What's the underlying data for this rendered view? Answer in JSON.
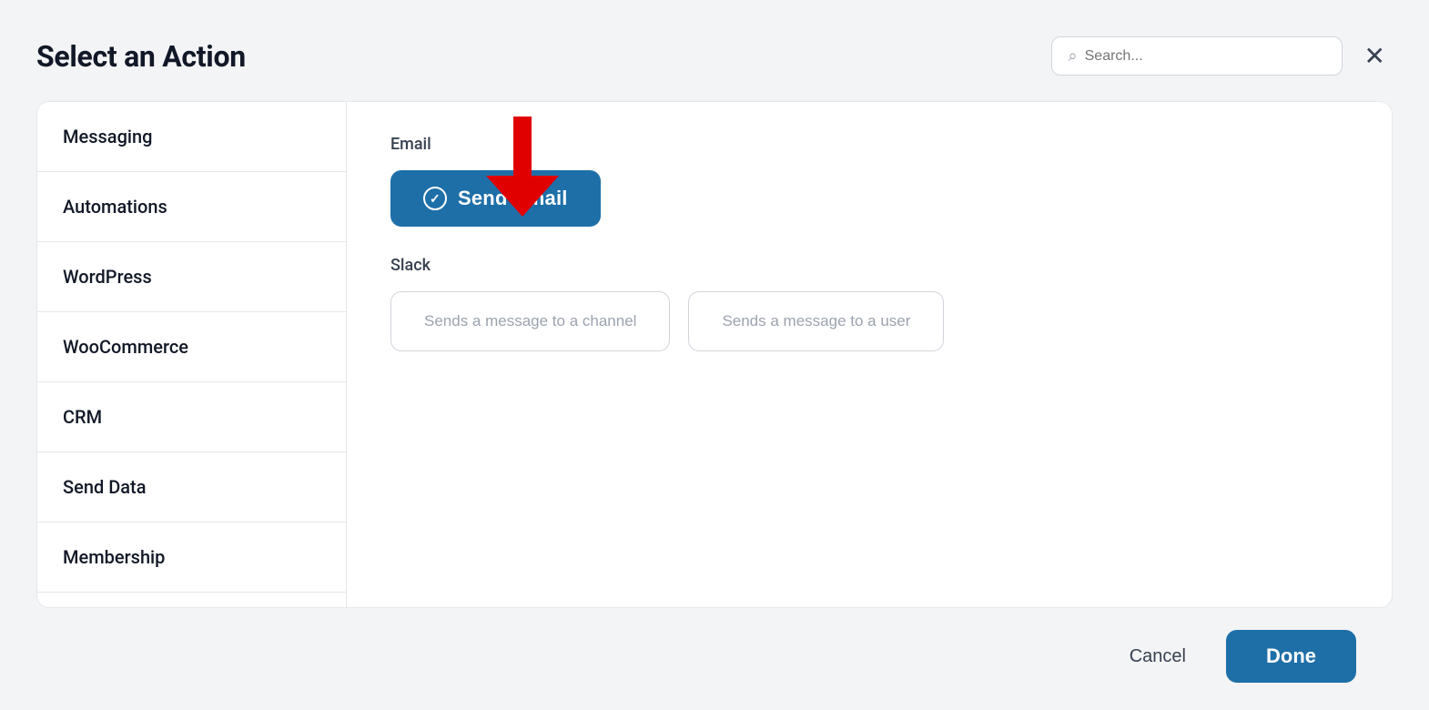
{
  "header": {
    "title": "Select an Action",
    "search_placeholder": "Search...",
    "close_label": "✕"
  },
  "sidebar": {
    "items": [
      {
        "id": "messaging",
        "label": "Messaging",
        "active": false
      },
      {
        "id": "automations",
        "label": "Automations",
        "active": false
      },
      {
        "id": "wordpress",
        "label": "WordPress",
        "active": false
      },
      {
        "id": "woocommerce",
        "label": "WooCommerce",
        "active": false
      },
      {
        "id": "crm",
        "label": "CRM",
        "active": false
      },
      {
        "id": "send-data",
        "label": "Send Data",
        "active": false
      },
      {
        "id": "membership",
        "label": "Membership",
        "active": false
      }
    ]
  },
  "main": {
    "email_section_label": "Email",
    "send_email_button_label": "Send Email",
    "slack_section_label": "Slack",
    "slack_options": [
      {
        "id": "channel",
        "label": "Sends a message to a channel"
      },
      {
        "id": "user",
        "label": "Sends a message to a user"
      }
    ]
  },
  "footer": {
    "cancel_label": "Cancel",
    "done_label": "Done"
  },
  "colors": {
    "accent": "#1e6fa8",
    "arrow_red": "#e00000"
  }
}
